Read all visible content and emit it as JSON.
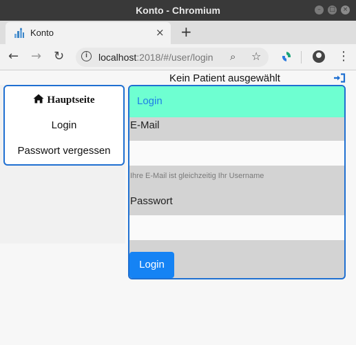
{
  "window": {
    "title": "Konto - Chromium"
  },
  "tab": {
    "label": "Konto",
    "close_glyph": "×",
    "new_tab_glyph": "+"
  },
  "toolbar": {
    "back_glyph": "←",
    "forward_glyph": "→",
    "reload_glyph": "↻",
    "url_host": "localhost",
    "url_rest": ":2018/#/user/login",
    "zoom_glyph": "⌕",
    "star_glyph": "☆",
    "menu_glyph": "⋮"
  },
  "page": {
    "patient_status": "Kein Patient ausgewählt",
    "sidebar": {
      "items": [
        {
          "label": "Hauptseite",
          "icon": "home-icon"
        },
        {
          "label": "Login"
        },
        {
          "label": "Passwort vergessen"
        }
      ]
    },
    "login_card": {
      "header": "Login",
      "email_label": "E-Mail",
      "email_value": "",
      "email_hint": "Ihre E-Mail ist gleichzeitig Ihr Username",
      "password_label": "Passwort",
      "password_value": "",
      "submit_label": "Login"
    }
  },
  "colors": {
    "accent_blue": "#1e6fd1",
    "button_blue": "#1583f4",
    "header_mint": "#6effd1",
    "header_text": "#1d7de6",
    "card_bg": "#d3d3d3"
  }
}
